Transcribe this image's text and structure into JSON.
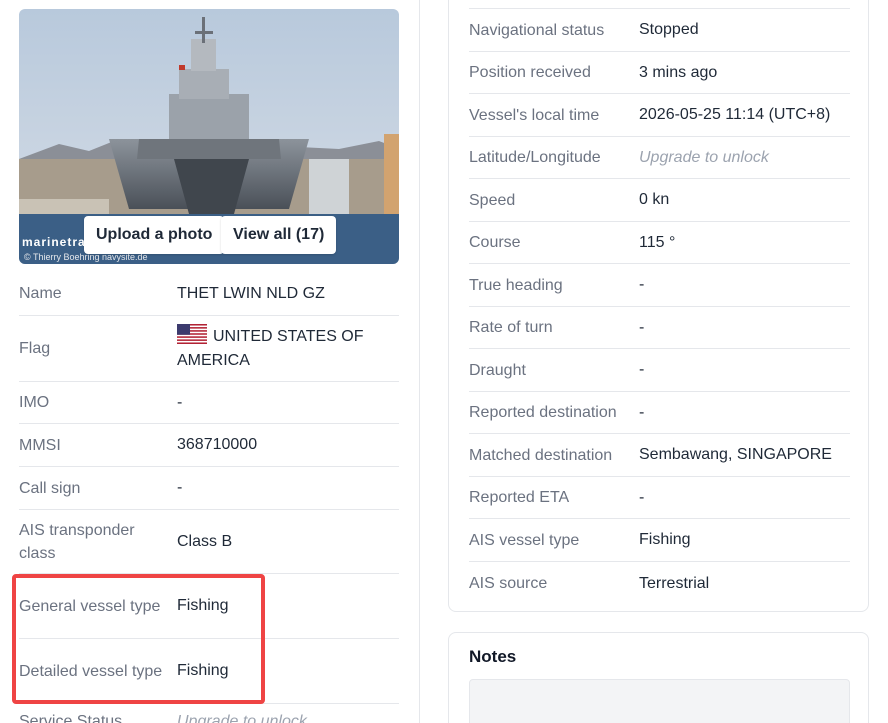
{
  "photo": {
    "upload_label": "Upload a photo",
    "view_all_label": "View all (17)",
    "watermark": "marinetraffic",
    "credit": "© Thierry Boehring navysite.de"
  },
  "vessel_left": [
    {
      "key": "Name",
      "value": "THET LWIN NLD GZ"
    },
    {
      "key": "Flag",
      "value": "UNITED STATES OF AMERICA",
      "icon": "us-flag-icon"
    },
    {
      "key": "IMO",
      "value": "-"
    },
    {
      "key": "MMSI",
      "value": "368710000"
    },
    {
      "key": "Call sign",
      "value": "-"
    },
    {
      "key": "AIS transponder class",
      "value": "Class B"
    },
    {
      "key": "General vessel type",
      "value": "Fishing"
    },
    {
      "key": "Detailed vessel type",
      "value": "Fishing"
    },
    {
      "key": "Service Status",
      "value": "Upgrade to unlock"
    }
  ],
  "voyage_right": [
    {
      "key": "Navigational status",
      "value": "Stopped"
    },
    {
      "key": "Position received",
      "value": "3 mins ago"
    },
    {
      "key": "Vessel's local time",
      "value": "2026-05-25 11:14 (UTC+8)"
    },
    {
      "key": "Latitude/Longitude",
      "value": "Upgrade to unlock"
    },
    {
      "key": "Speed",
      "value": "0 kn"
    },
    {
      "key": "Course",
      "value": "115 °"
    },
    {
      "key": "True heading",
      "value": "-"
    },
    {
      "key": "Rate of turn",
      "value": "-"
    },
    {
      "key": "Draught",
      "value": "-"
    },
    {
      "key": "Reported destination",
      "value": "-"
    },
    {
      "key": "Matched destination",
      "value": "Sembawang, SINGAPORE"
    },
    {
      "key": "Reported ETA",
      "value": "-"
    },
    {
      "key": "AIS vessel type",
      "value": "Fishing"
    },
    {
      "key": "AIS source",
      "value": "Terrestrial"
    }
  ],
  "notes": {
    "title": "Notes"
  },
  "colors": {
    "highlight": "#ef4444",
    "label": "#6b7280",
    "value": "#1f2937",
    "locked": "#9ca3af"
  }
}
